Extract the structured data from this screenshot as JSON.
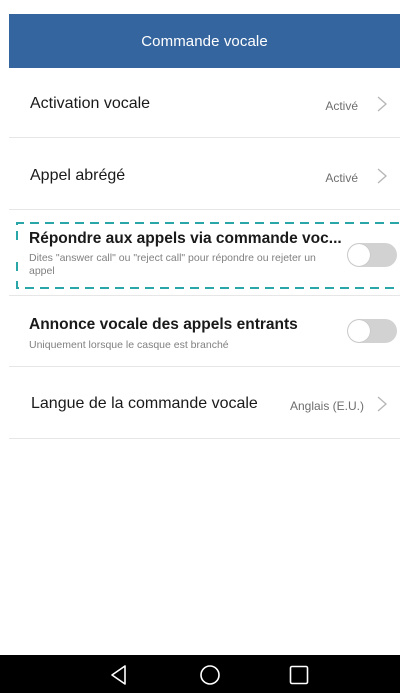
{
  "header": {
    "title": "Commande vocale",
    "background_color": "#35659f"
  },
  "settings": {
    "voice_activation": {
      "title": "Activation vocale",
      "value": "Activé"
    },
    "quick_call": {
      "title": "Appel abrégé",
      "value": "Activé"
    },
    "answer_calls": {
      "title": "Répondre aux appels via commande voc...",
      "subtitle": "Dites \"answer call\" ou \"reject call\" pour répondre ou rejeter un appel",
      "enabled": false
    },
    "announce_calls": {
      "title": "Annonce vocale des appels entrants",
      "subtitle": "Uniquement lorsque le casque est branché",
      "enabled": false
    },
    "language": {
      "title": "Langue de la commande vocale",
      "value": "Anglais (E.U.)"
    }
  },
  "highlight": {
    "color": "#2aa6a8",
    "style": "dashed"
  },
  "navigation": {
    "back_icon": "triangle-back-icon",
    "home_icon": "circle-home-icon",
    "recents_icon": "square-recents-icon"
  }
}
